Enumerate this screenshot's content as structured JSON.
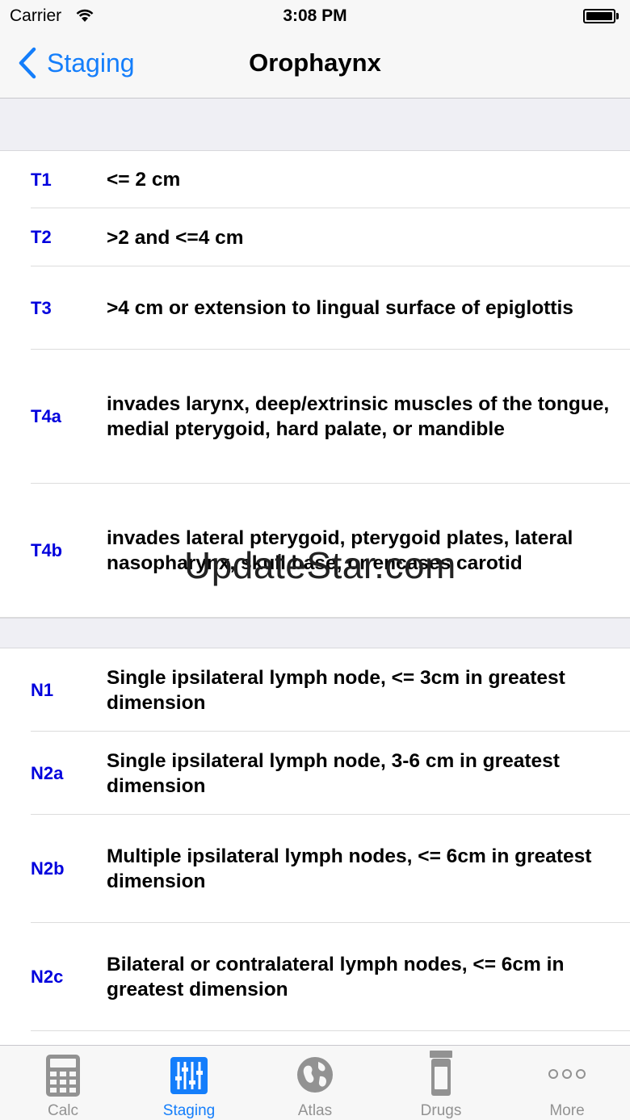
{
  "status_bar": {
    "carrier": "Carrier",
    "time": "3:08 PM"
  },
  "nav": {
    "back_label": "Staging",
    "title": "Orophaynx"
  },
  "t_section": [
    {
      "code": "T1",
      "description": "<= 2 cm"
    },
    {
      "code": "T2",
      "description": ">2 and <=4 cm"
    },
    {
      "code": "T3",
      "description": ">4 cm or extension to lingual surface of epiglottis"
    },
    {
      "code": "T4a",
      "description": "invades larynx, deep/extrinsic muscles of the tongue, medial pterygoid, hard palate, or mandible"
    },
    {
      "code": "T4b",
      "description": "invades lateral pterygoid, pterygoid plates, lateral nasopharynx, skull base, or encases carotid"
    }
  ],
  "n_section": [
    {
      "code": "N1",
      "description": "Single ipsilateral lymph node, <= 3cm in greatest dimension"
    },
    {
      "code": "N2a",
      "description": "Single ipsilateral lymph node, 3-6 cm in greatest dimension"
    },
    {
      "code": "N2b",
      "description": "Multiple ipsilateral lymph nodes, <= 6cm in greatest dimension"
    },
    {
      "code": "N2c",
      "description": "Bilateral or contralateral lymph nodes, <= 6cm in greatest dimension"
    }
  ],
  "watermark": "UpdateStar.com",
  "tab_bar": {
    "tabs": [
      {
        "label": "Calc",
        "icon": "calculator-icon",
        "active": false
      },
      {
        "label": "Staging",
        "icon": "sliders-icon",
        "active": true
      },
      {
        "label": "Atlas",
        "icon": "globe-icon",
        "active": false
      },
      {
        "label": "Drugs",
        "icon": "pill-bottle-icon",
        "active": false
      },
      {
        "label": "More",
        "icon": "more-icon",
        "active": false
      }
    ]
  },
  "colors": {
    "accent": "#147efb",
    "code_blue": "#0000dd",
    "inactive_tab": "#929292",
    "background": "#efeff4"
  }
}
